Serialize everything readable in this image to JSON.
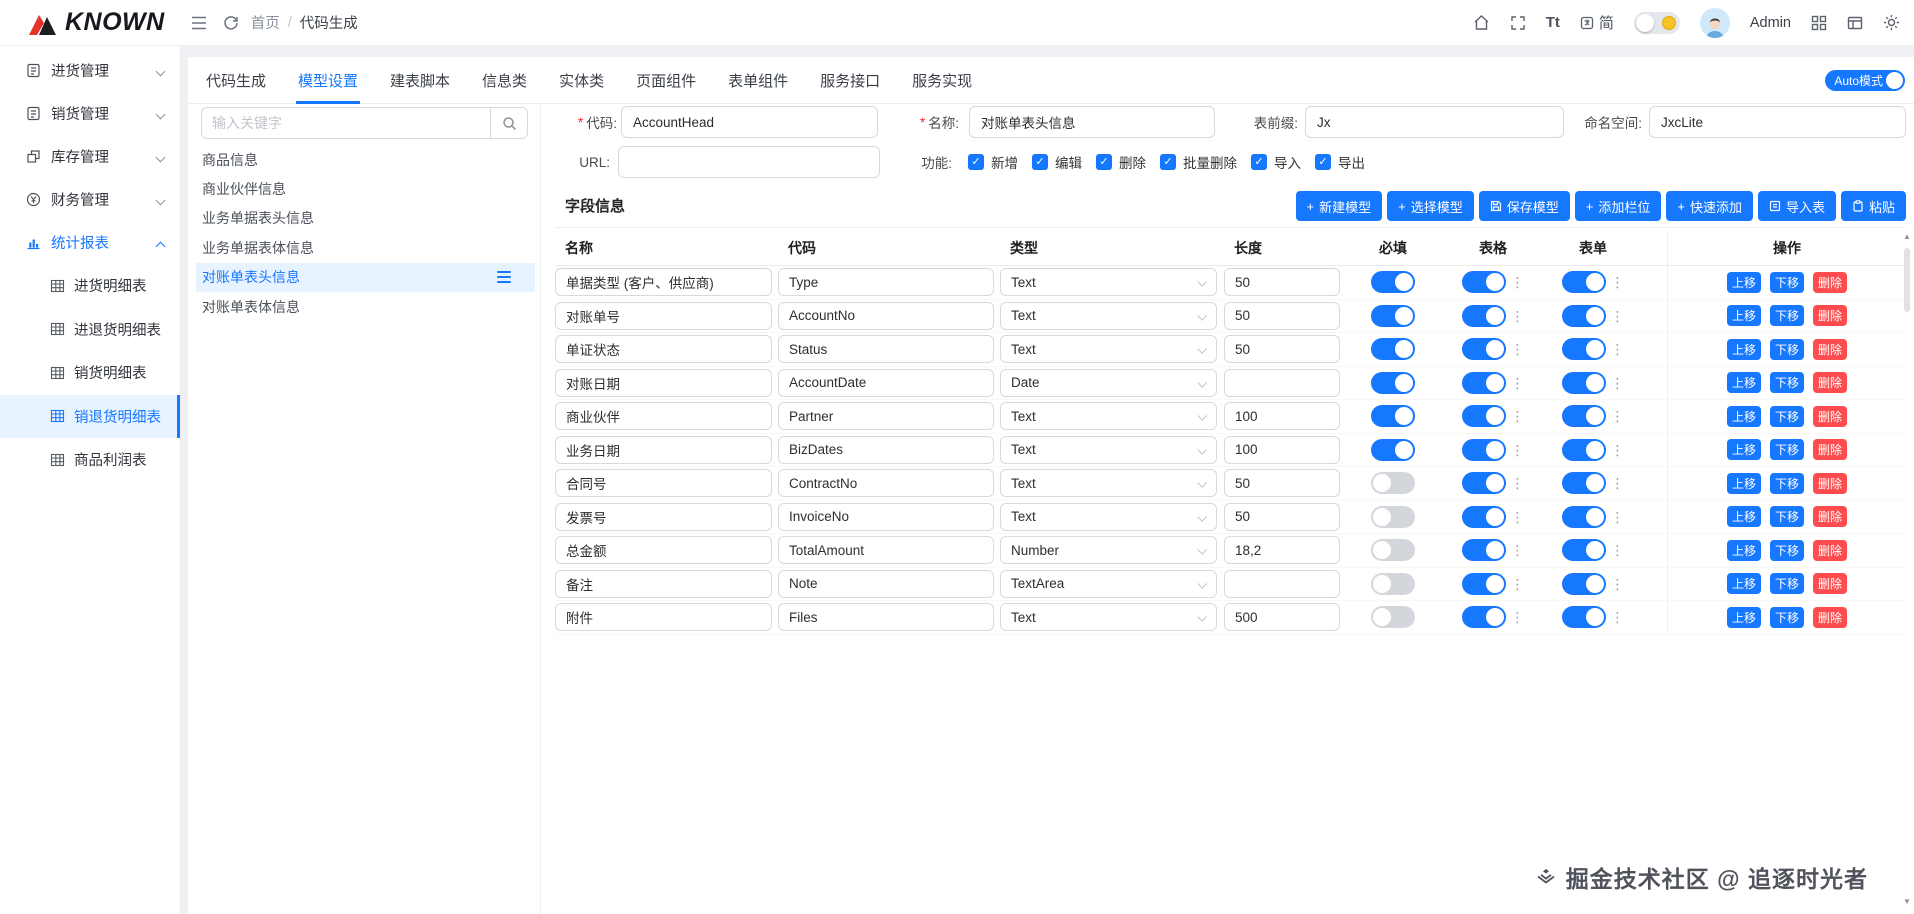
{
  "topbar": {
    "logo": "KNOWN",
    "breadcrumb_home": "首页",
    "breadcrumb_sep": "/",
    "breadcrumb_current": "代码生成",
    "font_size_label": "Tt",
    "lang_label": "简",
    "user_name": "Admin"
  },
  "colors": {
    "primary": "#1677ff",
    "danger": "#ff4d4f",
    "selected_bg": "#e7f4ff"
  },
  "sidebar": {
    "items": [
      {
        "label": "进货管理"
      },
      {
        "label": "销货管理"
      },
      {
        "label": "库存管理"
      },
      {
        "label": "财务管理"
      },
      {
        "label": "统计报表",
        "active": true,
        "expanded": true
      }
    ],
    "subitems": [
      {
        "label": "进货明细表"
      },
      {
        "label": "进退货明细表"
      },
      {
        "label": "销货明细表"
      },
      {
        "label": "销退货明细表",
        "selected": true
      },
      {
        "label": "商品利润表"
      }
    ]
  },
  "tabs": [
    {
      "label": "代码生成"
    },
    {
      "label": "模型设置",
      "active": true
    },
    {
      "label": "建表脚本"
    },
    {
      "label": "信息类"
    },
    {
      "label": "实体类"
    },
    {
      "label": "页面组件"
    },
    {
      "label": "表单组件"
    },
    {
      "label": "服务接口"
    },
    {
      "label": "服务实现"
    }
  ],
  "auto_mode": {
    "label": "Auto模式"
  },
  "model_panel": {
    "search_placeholder": "输入关键字",
    "items": [
      {
        "label": "商品信息"
      },
      {
        "label": "商业伙伴信息"
      },
      {
        "label": "业务单据表头信息"
      },
      {
        "label": "业务单据表体信息"
      },
      {
        "label": "对账单表头信息",
        "selected": true
      },
      {
        "label": "对账单表体信息"
      }
    ]
  },
  "form": {
    "code_label": "代码:",
    "code_value": "AccountHead",
    "name_label": "名称:",
    "name_value": "对账单表头信息",
    "prefix_label": "表前缀:",
    "prefix_value": "Jx",
    "namespace_label": "命名空间:",
    "namespace_value": "JxcLite",
    "url_label": "URL:",
    "url_value": "",
    "features_label": "功能:",
    "features": [
      {
        "label": "新增",
        "checked": true
      },
      {
        "label": "编辑",
        "checked": true
      },
      {
        "label": "删除",
        "checked": true
      },
      {
        "label": "批量删除",
        "checked": true
      },
      {
        "label": "导入",
        "checked": true
      },
      {
        "label": "导出",
        "checked": true
      }
    ]
  },
  "fields_section": {
    "title": "字段信息",
    "buttons": [
      {
        "icon": "plus",
        "label": "新建模型"
      },
      {
        "icon": "plus",
        "label": "选择模型"
      },
      {
        "icon": "save",
        "label": "保存模型"
      },
      {
        "icon": "plus",
        "label": "添加栏位"
      },
      {
        "icon": "plus",
        "label": "快速添加"
      },
      {
        "icon": "import",
        "label": "导入表"
      },
      {
        "icon": "paste",
        "label": "粘贴"
      }
    ]
  },
  "table": {
    "headers": {
      "name": "名称",
      "code": "代码",
      "type": "类型",
      "length": "长度",
      "required": "必填",
      "grid": "表格",
      "form": "表单",
      "ops": "操作"
    },
    "op_up": "上移",
    "op_down": "下移",
    "op_delete": "删除",
    "rows": [
      {
        "name": "单据类型 (客户、供应商)",
        "code": "Type",
        "type": "Text",
        "length": "50",
        "required": true,
        "grid": true,
        "form": true
      },
      {
        "name": "对账单号",
        "code": "AccountNo",
        "type": "Text",
        "length": "50",
        "required": true,
        "grid": true,
        "form": true
      },
      {
        "name": "单证状态",
        "code": "Status",
        "type": "Text",
        "length": "50",
        "required": true,
        "grid": true,
        "form": true
      },
      {
        "name": "对账日期",
        "code": "AccountDate",
        "type": "Date",
        "length": "",
        "required": true,
        "grid": true,
        "form": true
      },
      {
        "name": "商业伙伴",
        "code": "Partner",
        "type": "Text",
        "length": "100",
        "required": true,
        "grid": true,
        "form": true
      },
      {
        "name": "业务日期",
        "code": "BizDates",
        "type": "Text",
        "length": "100",
        "required": true,
        "grid": true,
        "form": true
      },
      {
        "name": "合同号",
        "code": "ContractNo",
        "type": "Text",
        "length": "50",
        "required": false,
        "grid": true,
        "form": true
      },
      {
        "name": "发票号",
        "code": "InvoiceNo",
        "type": "Text",
        "length": "50",
        "required": false,
        "grid": true,
        "form": true
      },
      {
        "name": "总金额",
        "code": "TotalAmount",
        "type": "Number",
        "length": "18,2",
        "required": false,
        "grid": true,
        "form": true
      },
      {
        "name": "备注",
        "code": "Note",
        "type": "TextArea",
        "length": "",
        "required": false,
        "grid": true,
        "form": true
      },
      {
        "name": "附件",
        "code": "Files",
        "type": "Text",
        "length": "500",
        "required": false,
        "grid": true,
        "form": true
      }
    ]
  },
  "watermark": "掘金技术社区 @ 追逐时光者"
}
